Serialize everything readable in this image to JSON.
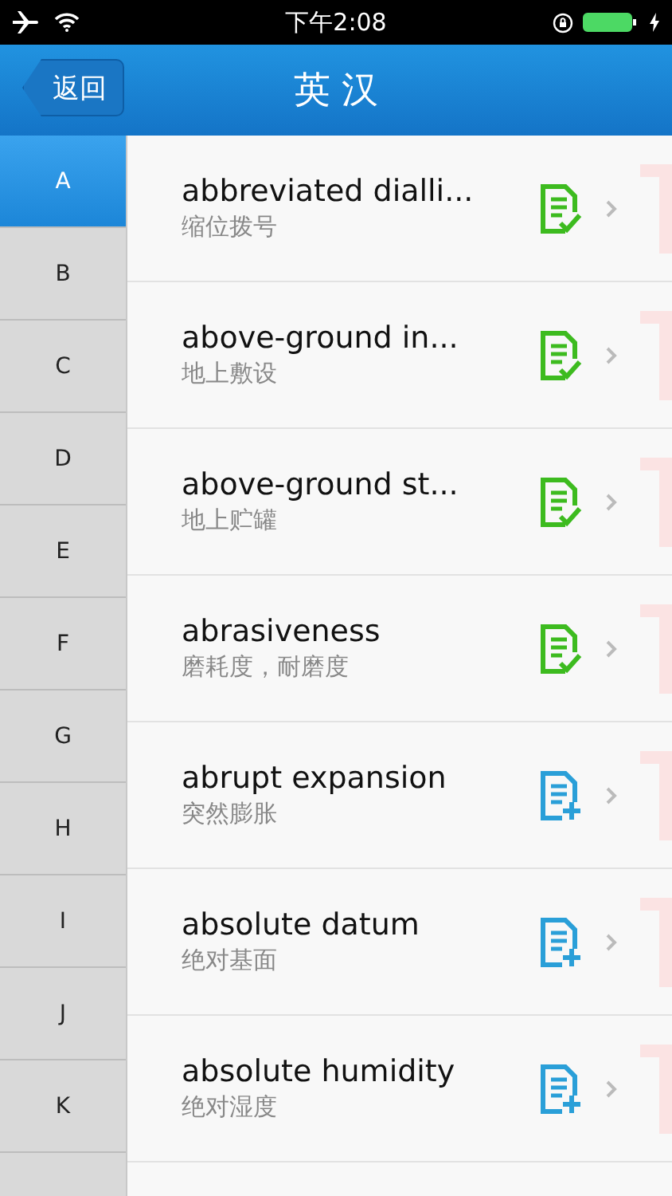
{
  "status_bar": {
    "time": "下午2:08"
  },
  "nav": {
    "back": "返回",
    "title": "英 汉"
  },
  "index": [
    {
      "letter": "A",
      "selected": true
    },
    {
      "letter": "B",
      "selected": false
    },
    {
      "letter": "C",
      "selected": false
    },
    {
      "letter": "D",
      "selected": false
    },
    {
      "letter": "E",
      "selected": false
    },
    {
      "letter": "F",
      "selected": false
    },
    {
      "letter": "G",
      "selected": false
    },
    {
      "letter": "H",
      "selected": false
    },
    {
      "letter": "I",
      "selected": false
    },
    {
      "letter": "J",
      "selected": false
    },
    {
      "letter": "K",
      "selected": false
    }
  ],
  "entries": [
    {
      "term": "abbreviated dialli...",
      "meaning": "缩位拨号",
      "kind": "saved"
    },
    {
      "term": "above-ground in...",
      "meaning": "地上敷设",
      "kind": "saved"
    },
    {
      "term": "above-ground st...",
      "meaning": "地上贮罐",
      "kind": "saved"
    },
    {
      "term": "abrasiveness",
      "meaning": "磨耗度，耐磨度",
      "kind": "saved"
    },
    {
      "term": "abrupt expansion",
      "meaning": "突然膨胀",
      "kind": "add"
    },
    {
      "term": "absolute datum",
      "meaning": "绝对基面",
      "kind": "add"
    },
    {
      "term": "absolute humidity",
      "meaning": "绝对湿度",
      "kind": "add"
    }
  ]
}
